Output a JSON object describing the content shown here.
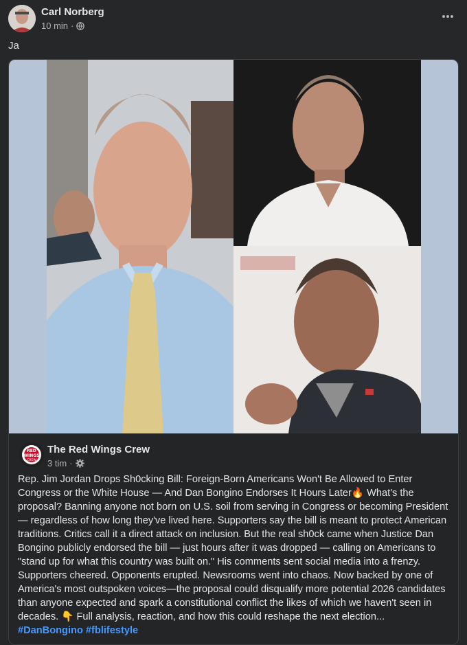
{
  "post": {
    "author": "Carl Norberg",
    "time": "10 min",
    "separator": "·",
    "text": "Ja",
    "icons": {
      "privacy": "globe-icon",
      "more": "more-horizontal-icon"
    }
  },
  "shared": {
    "page_name": "The Red Wings Crew",
    "time": "3 tim",
    "separator": "·",
    "logo_text_top": "RED",
    "logo_text_mid": "WINGS",
    "logo_text_bot": "CREW",
    "icons": {
      "privacy": "gear-icon"
    },
    "body": "Rep. Jim Jordan Drops Sh0cking Bill: Foreign-Born Americans Won't Be Allowed to Enter Congress or the White House — And Dan Bongino Endorses It Hours Later🔥 What's the proposal? Banning anyone not born on U.S. soil from serving in Congress or becoming President — regardless of how long they've lived here. Supporters say the bill is meant to protect American traditions. Critics call it a direct attack on inclusion. But the real sh0ck came when Justice Dan Bongino publicly endorsed the bill — just hours after it was dropped — calling on Americans to \"stand up for what this country was built on.\" His comments sent social media into a frenzy. Supporters cheered. Opponents erupted. Newsrooms went into chaos. Now backed by one of America's most outspoken voices—the proposal could disqualify more potential 2026 candidates than anyone expected and spark a constitutional conflict the likes of which we haven't seen in decades. 👇 Full analysis, reaction, and how this could reshape the next election... ",
    "hashtags": [
      "#DanBongino",
      "#fblifestyle"
    ]
  },
  "colors": {
    "background": "#252728",
    "photo_backdrop": "#b6c4d8",
    "hashtag": "#4599ff"
  }
}
